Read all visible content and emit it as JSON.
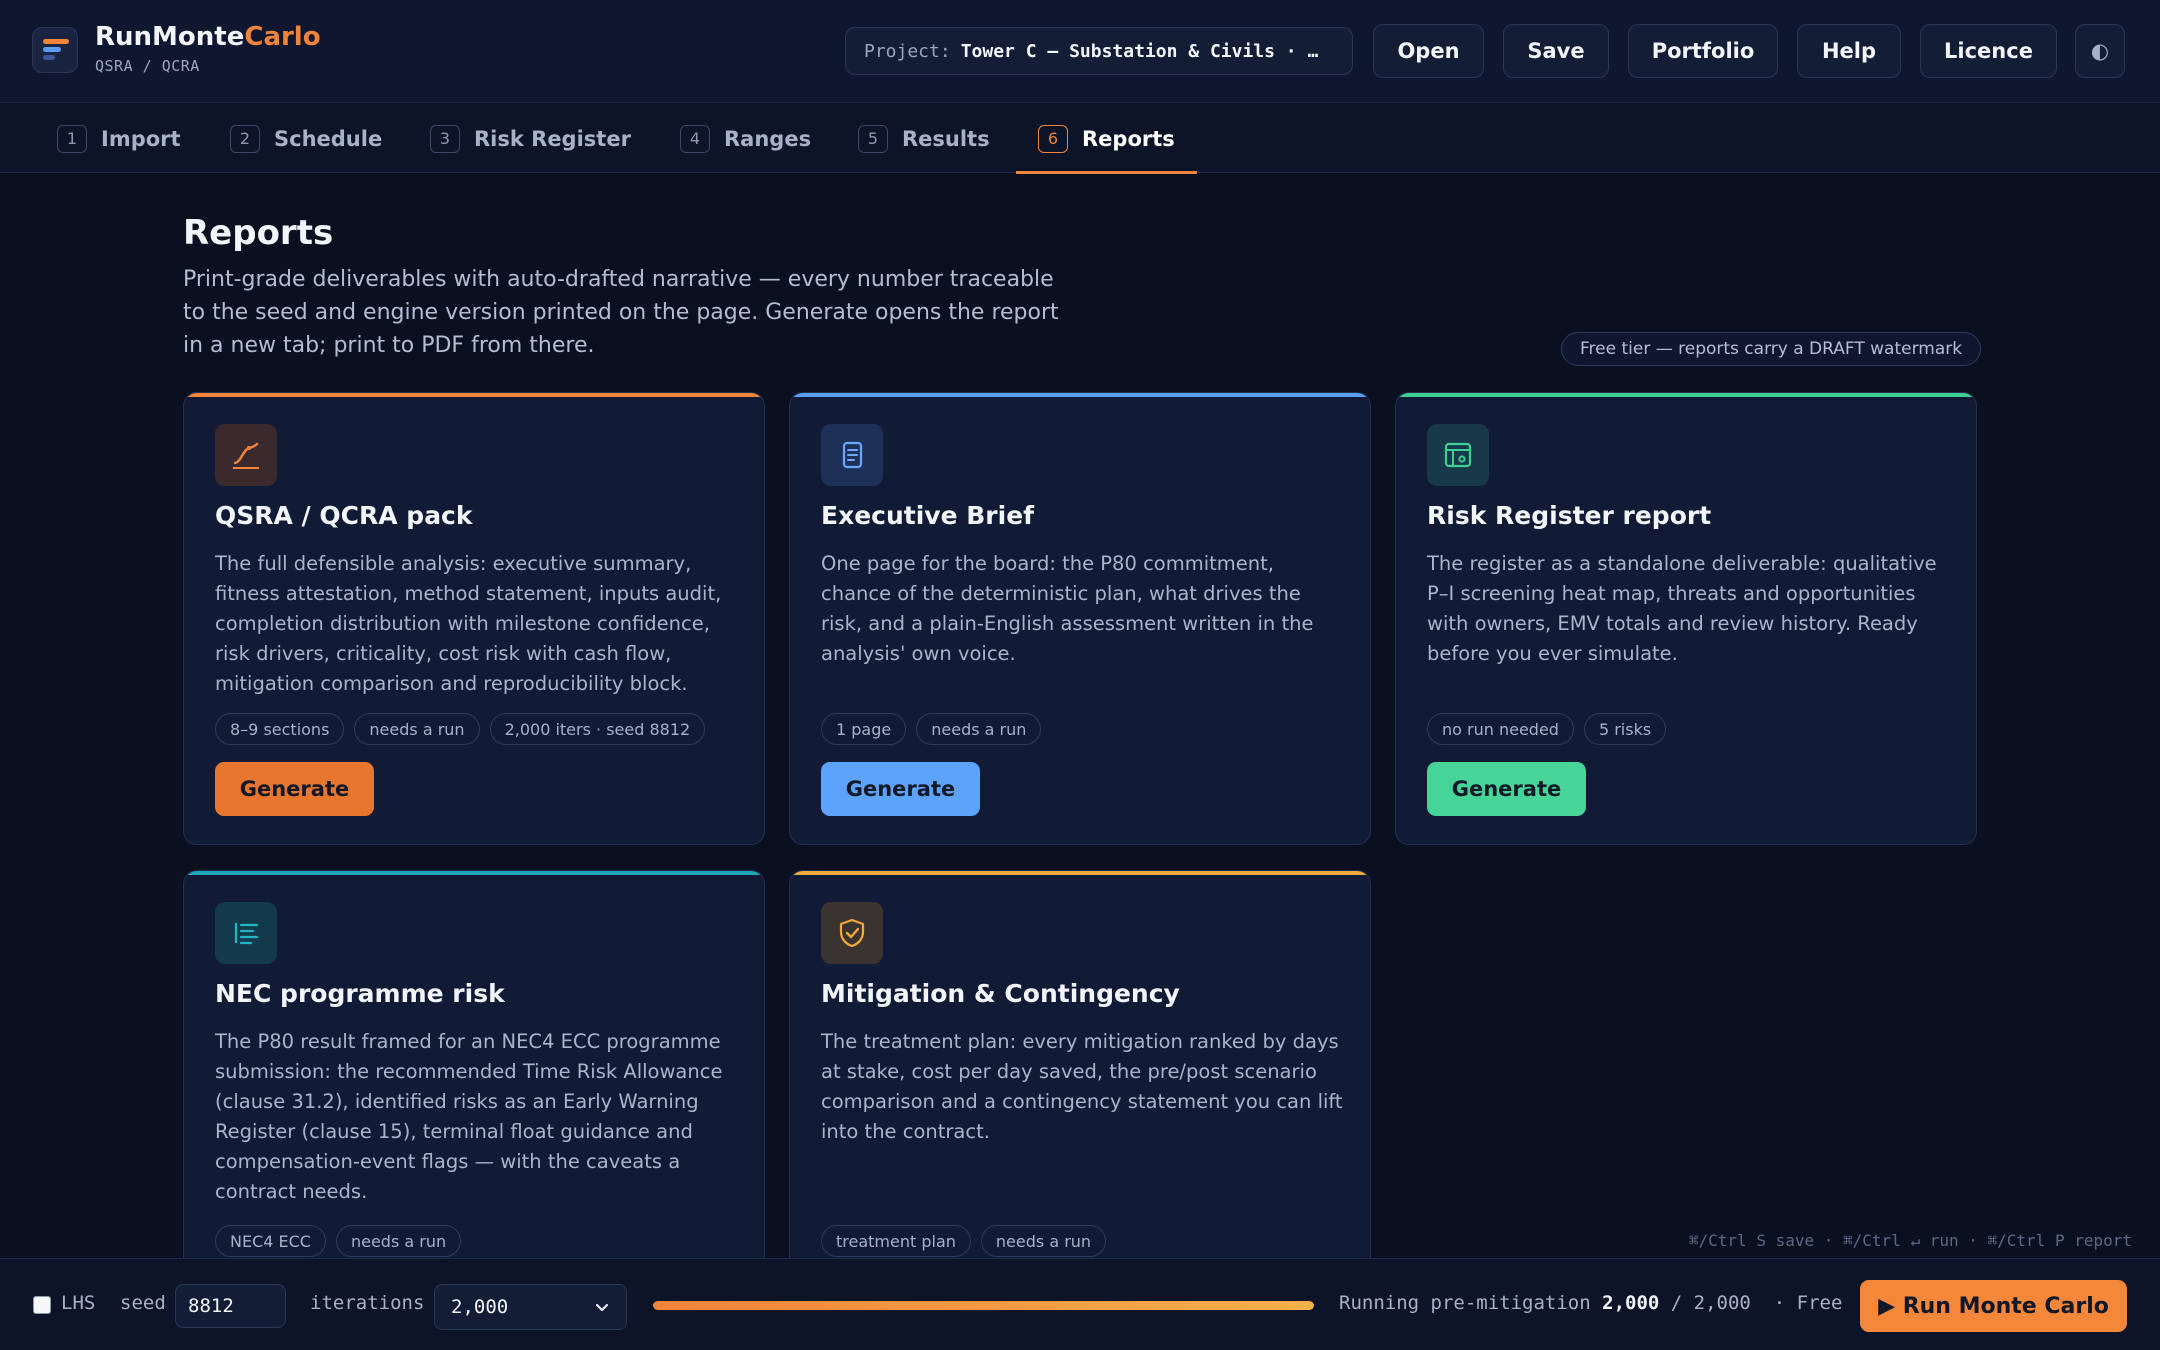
{
  "header": {
    "brand_a": "RunMonte",
    "brand_b": "Carlo",
    "subtitle": "QSRA / QCRA",
    "project_label": "Project:",
    "project_value": "Tower C — Substation & Civils · …",
    "buttons": {
      "open": "Open",
      "save": "Save",
      "portfolio": "Portfolio",
      "help": "Help",
      "licence": "Licence",
      "theme": "◐"
    }
  },
  "tabs": [
    {
      "num": "1",
      "label": "Import"
    },
    {
      "num": "2",
      "label": "Schedule"
    },
    {
      "num": "3",
      "label": "Risk Register"
    },
    {
      "num": "4",
      "label": "Ranges"
    },
    {
      "num": "5",
      "label": "Results"
    },
    {
      "num": "6",
      "label": "Reports",
      "active": true
    }
  ],
  "page": {
    "title": "Reports",
    "description": "Print-grade deliverables with auto-drafted narrative — every number traceable to the seed and engine version printed on the page. Generate opens the report in a new tab; print to PDF from there.",
    "tier_badge": "Free tier — reports carry a DRAFT watermark"
  },
  "cards": [
    {
      "title": "QSRA / QCRA pack",
      "icon": "chart-line-icon",
      "accent": "#f0843a",
      "description": "The full defensible analysis: executive summary, fitness attestation, method statement, inputs audit, completion distribution with milestone confidence, risk drivers, criticality, cost risk with cash flow, mitigation comparison and reproducibility block.",
      "chips": [
        "8–9 sections",
        "needs a run",
        "2,000 iters · seed 8812"
      ],
      "button": "Generate"
    },
    {
      "title": "Executive Brief",
      "icon": "document-icon",
      "accent": "#5b9cf5",
      "description": "One page for the board: the P80 commitment, chance of the deterministic plan, what drives the risk, and a plain-English assessment written in the analysis' own voice.",
      "chips": [
        "1 page",
        "needs a run"
      ],
      "button": "Generate"
    },
    {
      "title": "Risk Register report",
      "icon": "register-icon",
      "accent": "#3fcf93",
      "description": "The register as a standalone deliverable: qualitative P–I screening heat map, threats and opportunities with owners, EMV totals and review history. Ready before you ever simulate.",
      "chips": [
        "no run needed",
        "5 risks"
      ],
      "button": "Generate"
    },
    {
      "title": "NEC programme risk",
      "icon": "align-left-icon",
      "accent": "#1ea5b8",
      "description": "The P80 result framed for an NEC4 ECC programme submission: the recommended Time Risk Allowance (clause 31.2), identified risks as an Early Warning Register (clause 15), terminal float guidance and compensation-event flags — with the caveats a contract needs.",
      "chips": [
        "NEC4 ECC",
        "needs a run"
      ]
    },
    {
      "title": "Mitigation & Contingency",
      "icon": "shield-check-icon",
      "accent": "#f2a93b",
      "description": "The treatment plan: every mitigation ranked by days at stake, cost per day saved, the pre/post scenario comparison and a contingency statement you can lift into the contract.",
      "chips": [
        "treatment plan",
        "needs a run"
      ]
    }
  ],
  "shortcuts": "⌘/Ctrl S save · ⌘/Ctrl ↵ run · ⌘/Ctrl P report",
  "bottom": {
    "lhs_label": "LHS",
    "seed_label": "seed",
    "seed_value": "8812",
    "iterations_label": "iterations",
    "iterations_value": "2,000",
    "progress": 1.0,
    "status_prefix": "Running pre-mitigation",
    "status_done": "2,000",
    "status_total": "/ 2,000",
    "status_tier": "· Free",
    "run_button": "▶ Run Monte Carlo"
  }
}
